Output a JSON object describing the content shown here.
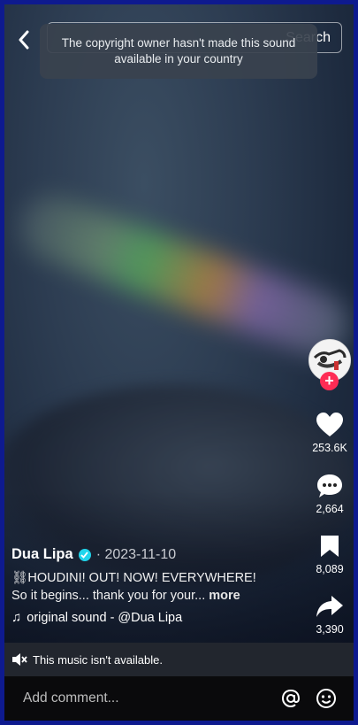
{
  "header": {
    "search_label": "Search",
    "toast_text": "The copyright owner hasn't made this sound available in your country"
  },
  "actions": {
    "likes": "253.6K",
    "comments": "2,664",
    "saves": "8,089",
    "shares": "3,390"
  },
  "post": {
    "author": "Dua Lipa",
    "date": "· 2023-11-10",
    "caption_line1": "⛓HOUDINI! OUT! NOW! EVERYWHERE!",
    "caption_line2": "So it begins... thank you for your...",
    "more_label": "more",
    "sound": "original sound - @Dua Lipa"
  },
  "notice": {
    "text": "This music isn't available."
  },
  "comment": {
    "placeholder": "Add comment..."
  },
  "colors": {
    "accent_red": "#fe2c55",
    "verified_blue": "#20d5ec",
    "border_blue": "#0e1a8f"
  }
}
